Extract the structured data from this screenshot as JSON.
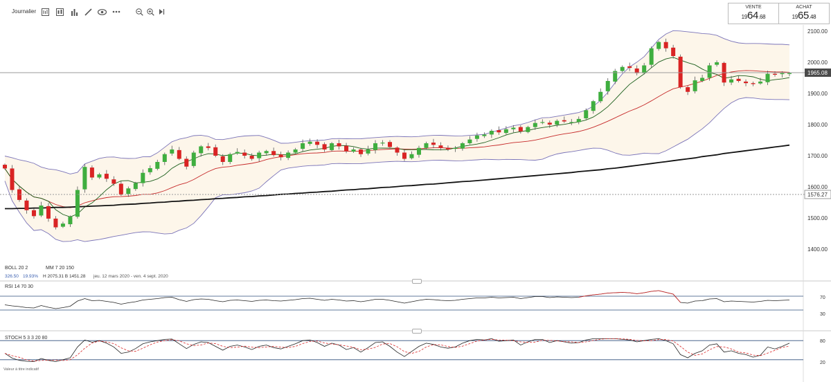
{
  "toolbar": {
    "timeframe": "Journalier",
    "icons": [
      "chart-type-icon",
      "compare-icon",
      "indicators-icon",
      "draw-icon",
      "view-icon",
      "more-icon",
      "zoom-out-icon",
      "zoom-in-icon",
      "play-icon"
    ]
  },
  "quotes": {
    "sell": {
      "label": "VENTE",
      "prefix": "19",
      "big": "64",
      "small": ".68"
    },
    "buy": {
      "label": "ACHAT",
      "prefix": "19",
      "big": "65",
      "small": ".48"
    }
  },
  "legend": {
    "boll": "BOLL 20 2",
    "mm": "MM 7 20 150",
    "boll_values": [
      "326.50",
      "19.93%"
    ],
    "high_low": "H 2075.31  B 1451.28",
    "period": "jeu. 12 mars 2020 - ven. 4 sept. 2020",
    "rsi": "RSI 14 70 30",
    "stoch": "STOCH 5 3 3 20 80",
    "disclaimer": "Valeur à titre indicatif"
  },
  "price_axis": {
    "ticks": [
      "2100.00",
      "2000.00",
      "1900.00",
      "1800.00",
      "1700.00",
      "1600.00",
      "1500.00",
      "1400.00"
    ],
    "last_price": "1965.08",
    "ref_price": "1576.27"
  },
  "rsi_axis": {
    "ticks": [
      "70",
      "30"
    ]
  },
  "stoch_axis": {
    "ticks": [
      "80",
      "20"
    ]
  },
  "colors": {
    "up": "#3fae3f",
    "down": "#d92424",
    "bb": "#7a73b8",
    "ma7": "#1b5e1b",
    "ma20": "#c62828",
    "ma150": "#111111",
    "bbfill": "#fdf6ea"
  },
  "chart_data": {
    "type": "candlestick",
    "start_date": "2020-03-12",
    "end_date": "2020-09-04",
    "close": [
      1659,
      1590,
      1558,
      1525,
      1506,
      1540,
      1498,
      1470,
      1482,
      1504,
      1590,
      1664,
      1630,
      1640,
      1626,
      1610,
      1575,
      1595,
      1612,
      1645,
      1660,
      1680,
      1705,
      1720,
      1690,
      1665,
      1710,
      1730,
      1725,
      1700,
      1680,
      1705,
      1712,
      1700,
      1690,
      1710,
      1715,
      1702,
      1695,
      1710,
      1720,
      1740,
      1745,
      1735,
      1720,
      1740,
      1730,
      1715,
      1720,
      1705,
      1720,
      1740,
      1742,
      1728,
      1710,
      1690,
      1705,
      1725,
      1740,
      1735,
      1725,
      1720,
      1725,
      1740,
      1752,
      1765,
      1768,
      1780,
      1775,
      1785,
      1790,
      1778,
      1792,
      1805,
      1808,
      1800,
      1812,
      1810,
      1808,
      1818,
      1846,
      1875,
      1905,
      1940,
      1972,
      1985,
      1982,
      1965,
      1990,
      2045,
      2065,
      2045,
      2020,
      1920,
      1905,
      1942,
      1950,
      1990,
      2000,
      1935,
      1945,
      1940,
      1933,
      1930,
      1938,
      1963,
      1960,
      1965,
      1965
    ],
    "ma150": [
      1530,
      1530,
      1531,
      1531,
      1532,
      1532,
      1533,
      1534,
      1534,
      1535,
      1536,
      1537,
      1538,
      1539,
      1540,
      1541,
      1543,
      1544,
      1545,
      1547,
      1548,
      1550,
      1551,
      1553,
      1554,
      1556,
      1557,
      1559,
      1560,
      1562,
      1563,
      1565,
      1566,
      1568,
      1569,
      1571,
      1572,
      1574,
      1576,
      1577,
      1579,
      1580,
      1582,
      1583,
      1585,
      1586,
      1588,
      1590,
      1591,
      1593,
      1594,
      1596,
      1598,
      1599,
      1601,
      1603,
      1604,
      1606,
      1608,
      1609,
      1611,
      1613,
      1615,
      1617,
      1618,
      1620,
      1622,
      1624,
      1626,
      1628,
      1630,
      1632,
      1634,
      1636,
      1638,
      1640,
      1642,
      1644,
      1646,
      1649,
      1651,
      1653,
      1655,
      1658,
      1660,
      1663,
      1666,
      1669,
      1672,
      1675,
      1678,
      1681,
      1684,
      1687,
      1690,
      1693,
      1697,
      1700,
      1703,
      1707,
      1710,
      1713,
      1716,
      1719,
      1722,
      1725,
      1728,
      1731,
      1734
    ],
    "rsi": [
      45,
      42,
      40,
      37,
      36,
      43,
      38,
      34,
      37,
      41,
      56,
      63,
      57,
      58,
      55,
      52,
      47,
      51,
      54,
      59,
      61,
      63,
      66,
      67,
      60,
      55,
      60,
      62,
      61,
      57,
      54,
      58,
      59,
      57,
      55,
      58,
      59,
      57,
      56,
      58,
      60,
      63,
      64,
      61,
      58,
      61,
      59,
      56,
      57,
      54,
      57,
      61,
      61,
      58,
      54,
      50,
      54,
      58,
      61,
      60,
      58,
      57,
      58,
      61,
      63,
      65,
      65,
      67,
      65,
      66,
      67,
      63,
      66,
      69,
      69,
      66,
      68,
      67,
      66,
      67,
      71,
      74,
      76,
      79,
      80,
      81,
      80,
      77,
      80,
      84,
      86,
      81,
      76,
      52,
      50,
      56,
      57,
      62,
      63,
      54,
      56,
      55,
      54,
      53,
      55,
      58,
      57,
      58,
      59
    ],
    "stoch": [
      40,
      25,
      18,
      15,
      14,
      24,
      18,
      14,
      20,
      26,
      60,
      82,
      75,
      80,
      72,
      60,
      40,
      44,
      55,
      70,
      76,
      80,
      84,
      85,
      70,
      55,
      68,
      76,
      74,
      62,
      50,
      62,
      66,
      60,
      52,
      62,
      66,
      58,
      54,
      62,
      70,
      80,
      82,
      74,
      62,
      72,
      66,
      52,
      58,
      44,
      58,
      74,
      76,
      62,
      44,
      30,
      46,
      62,
      72,
      68,
      60,
      56,
      60,
      72,
      80,
      84,
      82,
      86,
      78,
      80,
      82,
      66,
      76,
      84,
      84,
      74,
      80,
      76,
      72,
      74,
      82,
      86,
      86,
      86,
      86,
      84,
      82,
      76,
      80,
      84,
      86,
      80,
      70,
      36,
      26,
      40,
      48,
      66,
      70,
      44,
      48,
      40,
      36,
      28,
      34,
      60,
      54,
      62,
      72
    ],
    "ylim": [
      1370,
      2110
    ]
  }
}
